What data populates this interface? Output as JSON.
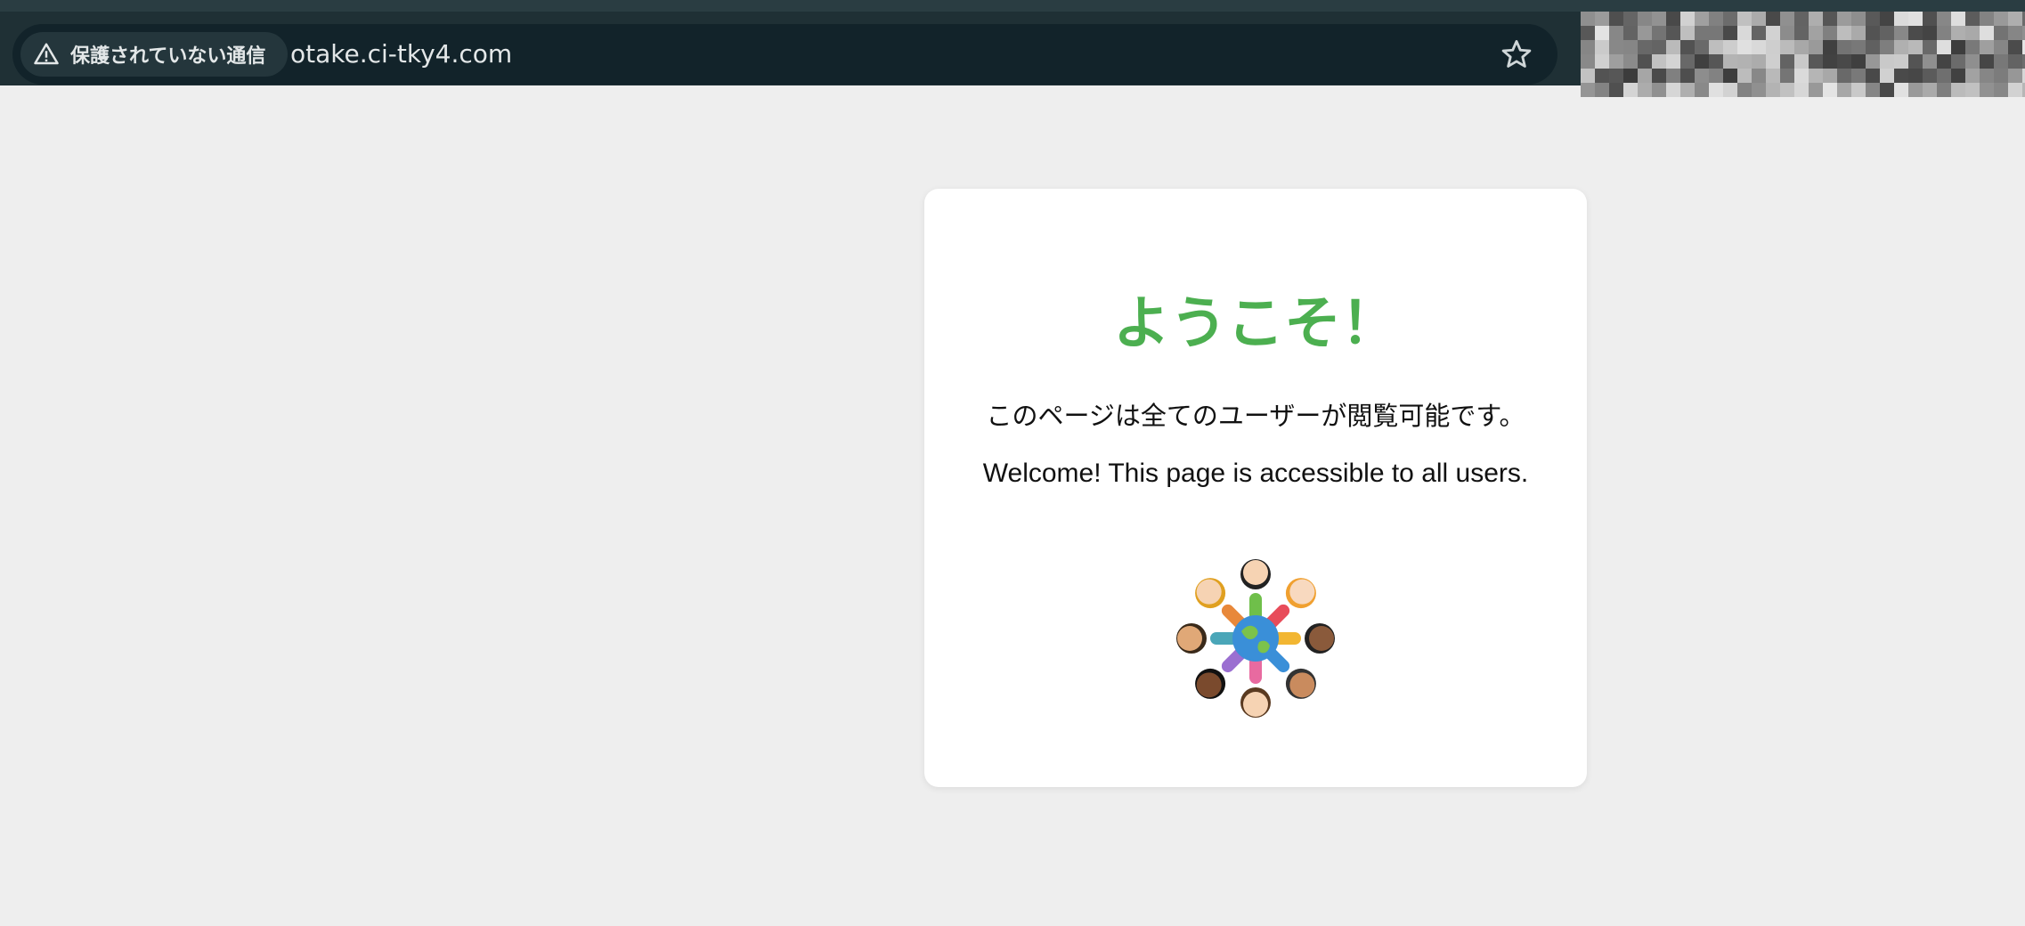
{
  "browser": {
    "security_label": "保護されていない通信",
    "url": "otake.ci-tky4.com",
    "icons": {
      "security": "warning-triangle-icon",
      "bookmark": "star-icon"
    }
  },
  "page": {
    "heading": "ようこそ！",
    "message_ja": "このページは全てのユーザーが閲覧可能です。",
    "message_en": "Welcome! This page is accessible to all users.",
    "illustration": "children-around-globe-illustration"
  },
  "colors": {
    "heading": "#4caf50",
    "page_background": "#eeeeee",
    "card_background": "#ffffff",
    "toolbar": "#1f3035"
  }
}
